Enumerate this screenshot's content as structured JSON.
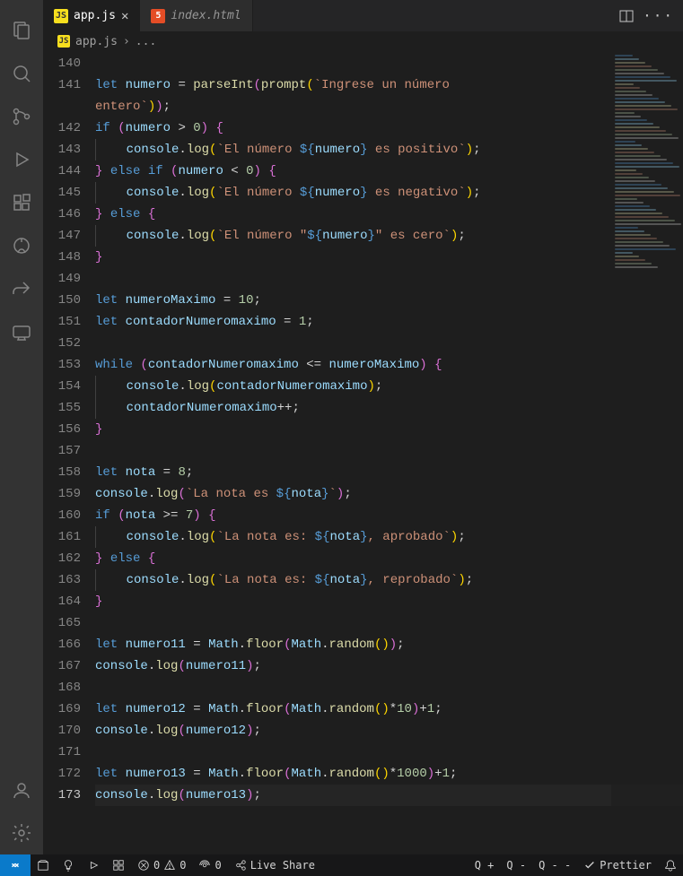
{
  "tabs": [
    {
      "icon": "JS",
      "icon_class": "js",
      "label": "app.js",
      "active": true,
      "closeable": true,
      "italic": false
    },
    {
      "icon": "5",
      "icon_class": "html",
      "label": "index.html",
      "active": false,
      "closeable": false,
      "italic": true
    }
  ],
  "breadcrumb": {
    "icon": "JS",
    "file": "app.js",
    "sep": "›",
    "more": "..."
  },
  "line_start": 140,
  "line_end": 173,
  "current_line": 173,
  "code": [
    {
      "n": 140,
      "indent": 0,
      "tokens": []
    },
    {
      "n": 141,
      "indent": 0,
      "tokens": [
        [
          "kw",
          "let"
        ],
        [
          "pn",
          " "
        ],
        [
          "var",
          "numero"
        ],
        [
          "pn",
          " = "
        ],
        [
          "fn",
          "parseInt"
        ],
        [
          "pr",
          "("
        ],
        [
          "fn",
          "prompt"
        ],
        [
          "brace-y",
          "("
        ],
        [
          "str",
          "`Ingrese un número "
        ]
      ]
    },
    {
      "n": 141,
      "cont": true,
      "indent": 0,
      "tokens": [
        [
          "str",
          "entero`"
        ],
        [
          "brace-y",
          ")"
        ],
        [
          "pr",
          ")"
        ],
        [
          "pn",
          ";"
        ]
      ]
    },
    {
      "n": 142,
      "indent": 0,
      "tokens": [
        [
          "kw",
          "if"
        ],
        [
          "pn",
          " "
        ],
        [
          "pr",
          "("
        ],
        [
          "var",
          "numero"
        ],
        [
          "pn",
          " > "
        ],
        [
          "num",
          "0"
        ],
        [
          "pr",
          ")"
        ],
        [
          "pn",
          " "
        ],
        [
          "pr",
          "{"
        ]
      ]
    },
    {
      "n": 143,
      "indent": 1,
      "tokens": [
        [
          "var",
          "console"
        ],
        [
          "pn",
          "."
        ],
        [
          "fn",
          "log"
        ],
        [
          "brace-y",
          "("
        ],
        [
          "str",
          "`El número "
        ],
        [
          "tmpl",
          "${"
        ],
        [
          "var",
          "numero"
        ],
        [
          "tmpl",
          "}"
        ],
        [
          "str",
          " es positivo`"
        ],
        [
          "brace-y",
          ")"
        ],
        [
          "pn",
          ";"
        ]
      ]
    },
    {
      "n": 144,
      "indent": 0,
      "tokens": [
        [
          "pr",
          "}"
        ],
        [
          "pn",
          " "
        ],
        [
          "kw",
          "else"
        ],
        [
          "pn",
          " "
        ],
        [
          "kw",
          "if"
        ],
        [
          "pn",
          " "
        ],
        [
          "pr",
          "("
        ],
        [
          "var",
          "numero"
        ],
        [
          "pn",
          " < "
        ],
        [
          "num",
          "0"
        ],
        [
          "pr",
          ")"
        ],
        [
          "pn",
          " "
        ],
        [
          "pr",
          "{"
        ]
      ]
    },
    {
      "n": 145,
      "indent": 1,
      "tokens": [
        [
          "var",
          "console"
        ],
        [
          "pn",
          "."
        ],
        [
          "fn",
          "log"
        ],
        [
          "brace-y",
          "("
        ],
        [
          "str",
          "`El número "
        ],
        [
          "tmpl",
          "${"
        ],
        [
          "var",
          "numero"
        ],
        [
          "tmpl",
          "}"
        ],
        [
          "str",
          " es negativo`"
        ],
        [
          "brace-y",
          ")"
        ],
        [
          "pn",
          ";"
        ]
      ]
    },
    {
      "n": 146,
      "indent": 0,
      "tokens": [
        [
          "pr",
          "}"
        ],
        [
          "pn",
          " "
        ],
        [
          "kw",
          "else"
        ],
        [
          "pn",
          " "
        ],
        [
          "pr",
          "{"
        ]
      ]
    },
    {
      "n": 147,
      "indent": 1,
      "tokens": [
        [
          "var",
          "console"
        ],
        [
          "pn",
          "."
        ],
        [
          "fn",
          "log"
        ],
        [
          "brace-y",
          "("
        ],
        [
          "str",
          "`El número \""
        ],
        [
          "tmpl",
          "${"
        ],
        [
          "var",
          "numero"
        ],
        [
          "tmpl",
          "}"
        ],
        [
          "str",
          "\" es cero`"
        ],
        [
          "brace-y",
          ")"
        ],
        [
          "pn",
          ";"
        ]
      ]
    },
    {
      "n": 148,
      "indent": 0,
      "tokens": [
        [
          "pr",
          "}"
        ]
      ]
    },
    {
      "n": 149,
      "indent": 0,
      "tokens": []
    },
    {
      "n": 150,
      "indent": 0,
      "tokens": [
        [
          "kw",
          "let"
        ],
        [
          "pn",
          " "
        ],
        [
          "var",
          "numeroMaximo"
        ],
        [
          "pn",
          " = "
        ],
        [
          "num",
          "10"
        ],
        [
          "pn",
          ";"
        ]
      ]
    },
    {
      "n": 151,
      "indent": 0,
      "tokens": [
        [
          "kw",
          "let"
        ],
        [
          "pn",
          " "
        ],
        [
          "var",
          "contadorNumeromaximo"
        ],
        [
          "pn",
          " = "
        ],
        [
          "num",
          "1"
        ],
        [
          "pn",
          ";"
        ]
      ]
    },
    {
      "n": 152,
      "indent": 0,
      "tokens": []
    },
    {
      "n": 153,
      "indent": 0,
      "tokens": [
        [
          "kw",
          "while"
        ],
        [
          "pn",
          " "
        ],
        [
          "pr",
          "("
        ],
        [
          "var",
          "contadorNumeromaximo"
        ],
        [
          "pn",
          " <= "
        ],
        [
          "var",
          "numeroMaximo"
        ],
        [
          "pr",
          ")"
        ],
        [
          "pn",
          " "
        ],
        [
          "pr",
          "{"
        ]
      ]
    },
    {
      "n": 154,
      "indent": 1,
      "tokens": [
        [
          "var",
          "console"
        ],
        [
          "pn",
          "."
        ],
        [
          "fn",
          "log"
        ],
        [
          "brace-y",
          "("
        ],
        [
          "var",
          "contadorNumeromaximo"
        ],
        [
          "brace-y",
          ")"
        ],
        [
          "pn",
          ";"
        ]
      ]
    },
    {
      "n": 155,
      "indent": 1,
      "tokens": [
        [
          "var",
          "contadorNumeromaximo"
        ],
        [
          "pn",
          "++;"
        ]
      ]
    },
    {
      "n": 156,
      "indent": 0,
      "tokens": [
        [
          "pr",
          "}"
        ]
      ]
    },
    {
      "n": 157,
      "indent": 0,
      "tokens": []
    },
    {
      "n": 158,
      "indent": 0,
      "tokens": [
        [
          "kw",
          "let"
        ],
        [
          "pn",
          " "
        ],
        [
          "var",
          "nota"
        ],
        [
          "pn",
          " = "
        ],
        [
          "num",
          "8"
        ],
        [
          "pn",
          ";"
        ]
      ]
    },
    {
      "n": 159,
      "indent": 0,
      "tokens": [
        [
          "var",
          "console"
        ],
        [
          "pn",
          "."
        ],
        [
          "fn",
          "log"
        ],
        [
          "pr",
          "("
        ],
        [
          "str",
          "`La nota es "
        ],
        [
          "tmpl",
          "${"
        ],
        [
          "var",
          "nota"
        ],
        [
          "tmpl",
          "}"
        ],
        [
          "str",
          "`"
        ],
        [
          "pr",
          ")"
        ],
        [
          "pn",
          ";"
        ]
      ]
    },
    {
      "n": 160,
      "indent": 0,
      "tokens": [
        [
          "kw",
          "if"
        ],
        [
          "pn",
          " "
        ],
        [
          "pr",
          "("
        ],
        [
          "var",
          "nota"
        ],
        [
          "pn",
          " >= "
        ],
        [
          "num",
          "7"
        ],
        [
          "pr",
          ")"
        ],
        [
          "pn",
          " "
        ],
        [
          "pr",
          "{"
        ]
      ]
    },
    {
      "n": 161,
      "indent": 1,
      "tokens": [
        [
          "var",
          "console"
        ],
        [
          "pn",
          "."
        ],
        [
          "fn",
          "log"
        ],
        [
          "brace-y",
          "("
        ],
        [
          "str",
          "`La nota es: "
        ],
        [
          "tmpl",
          "${"
        ],
        [
          "var",
          "nota"
        ],
        [
          "tmpl",
          "}"
        ],
        [
          "str",
          ", aprobado`"
        ],
        [
          "brace-y",
          ")"
        ],
        [
          "pn",
          ";"
        ]
      ]
    },
    {
      "n": 162,
      "indent": 0,
      "tokens": [
        [
          "pr",
          "}"
        ],
        [
          "pn",
          " "
        ],
        [
          "kw",
          "else"
        ],
        [
          "pn",
          " "
        ],
        [
          "pr",
          "{"
        ]
      ]
    },
    {
      "n": 163,
      "indent": 1,
      "tokens": [
        [
          "var",
          "console"
        ],
        [
          "pn",
          "."
        ],
        [
          "fn",
          "log"
        ],
        [
          "brace-y",
          "("
        ],
        [
          "str",
          "`La nota es: "
        ],
        [
          "tmpl",
          "${"
        ],
        [
          "var",
          "nota"
        ],
        [
          "tmpl",
          "}"
        ],
        [
          "str",
          ", reprobado`"
        ],
        [
          "brace-y",
          ")"
        ],
        [
          "pn",
          ";"
        ]
      ]
    },
    {
      "n": 164,
      "indent": 0,
      "tokens": [
        [
          "pr",
          "}"
        ]
      ]
    },
    {
      "n": 165,
      "indent": 0,
      "tokens": []
    },
    {
      "n": 166,
      "indent": 0,
      "tokens": [
        [
          "kw",
          "let"
        ],
        [
          "pn",
          " "
        ],
        [
          "var",
          "numero11"
        ],
        [
          "pn",
          " = "
        ],
        [
          "var",
          "Math"
        ],
        [
          "pn",
          "."
        ],
        [
          "fn",
          "floor"
        ],
        [
          "pr",
          "("
        ],
        [
          "var",
          "Math"
        ],
        [
          "pn",
          "."
        ],
        [
          "fn",
          "random"
        ],
        [
          "brace-y",
          "("
        ],
        [
          "brace-y",
          ")"
        ],
        [
          "pr",
          ")"
        ],
        [
          "pn",
          ";"
        ]
      ]
    },
    {
      "n": 167,
      "indent": 0,
      "tokens": [
        [
          "var",
          "console"
        ],
        [
          "pn",
          "."
        ],
        [
          "fn",
          "log"
        ],
        [
          "pr",
          "("
        ],
        [
          "var",
          "numero11"
        ],
        [
          "pr",
          ")"
        ],
        [
          "pn",
          ";"
        ]
      ]
    },
    {
      "n": 168,
      "indent": 0,
      "tokens": []
    },
    {
      "n": 169,
      "indent": 0,
      "tokens": [
        [
          "kw",
          "let"
        ],
        [
          "pn",
          " "
        ],
        [
          "var",
          "numero12"
        ],
        [
          "pn",
          " = "
        ],
        [
          "var",
          "Math"
        ],
        [
          "pn",
          "."
        ],
        [
          "fn",
          "floor"
        ],
        [
          "pr",
          "("
        ],
        [
          "var",
          "Math"
        ],
        [
          "pn",
          "."
        ],
        [
          "fn",
          "random"
        ],
        [
          "brace-y",
          "("
        ],
        [
          "brace-y",
          ")"
        ],
        [
          "pn",
          "*"
        ],
        [
          "num",
          "10"
        ],
        [
          "pr",
          ")"
        ],
        [
          "pn",
          "+"
        ],
        [
          "num",
          "1"
        ],
        [
          "pn",
          ";"
        ]
      ]
    },
    {
      "n": 170,
      "indent": 0,
      "tokens": [
        [
          "var",
          "console"
        ],
        [
          "pn",
          "."
        ],
        [
          "fn",
          "log"
        ],
        [
          "pr",
          "("
        ],
        [
          "var",
          "numero12"
        ],
        [
          "pr",
          ")"
        ],
        [
          "pn",
          ";"
        ]
      ]
    },
    {
      "n": 171,
      "indent": 0,
      "tokens": []
    },
    {
      "n": 172,
      "indent": 0,
      "tokens": [
        [
          "kw",
          "let"
        ],
        [
          "pn",
          " "
        ],
        [
          "var",
          "numero13"
        ],
        [
          "pn",
          " = "
        ],
        [
          "var",
          "Math"
        ],
        [
          "pn",
          "."
        ],
        [
          "fn",
          "floor"
        ],
        [
          "pr",
          "("
        ],
        [
          "var",
          "Math"
        ],
        [
          "pn",
          "."
        ],
        [
          "fn",
          "random"
        ],
        [
          "brace-y",
          "("
        ],
        [
          "brace-y",
          ")"
        ],
        [
          "pn",
          "*"
        ],
        [
          "num",
          "1000"
        ],
        [
          "pr",
          ")"
        ],
        [
          "pn",
          "+"
        ],
        [
          "num",
          "1"
        ],
        [
          "pn",
          ";"
        ]
      ]
    },
    {
      "n": 173,
      "indent": 0,
      "tokens": [
        [
          "var",
          "console"
        ],
        [
          "pn",
          "."
        ],
        [
          "fn",
          "log"
        ],
        [
          "pr",
          "("
        ],
        [
          "var",
          "numero13"
        ],
        [
          "pr",
          ")"
        ],
        [
          "pn",
          ";"
        ]
      ]
    }
  ],
  "status_bar": {
    "errors": "0",
    "warnings": "0",
    "ports": "0",
    "live_share": "Live Share",
    "quokka_plus": "Q +",
    "quokka_minus": "Q -",
    "quokka_stop": "Q - -",
    "prettier": "Prettier"
  }
}
